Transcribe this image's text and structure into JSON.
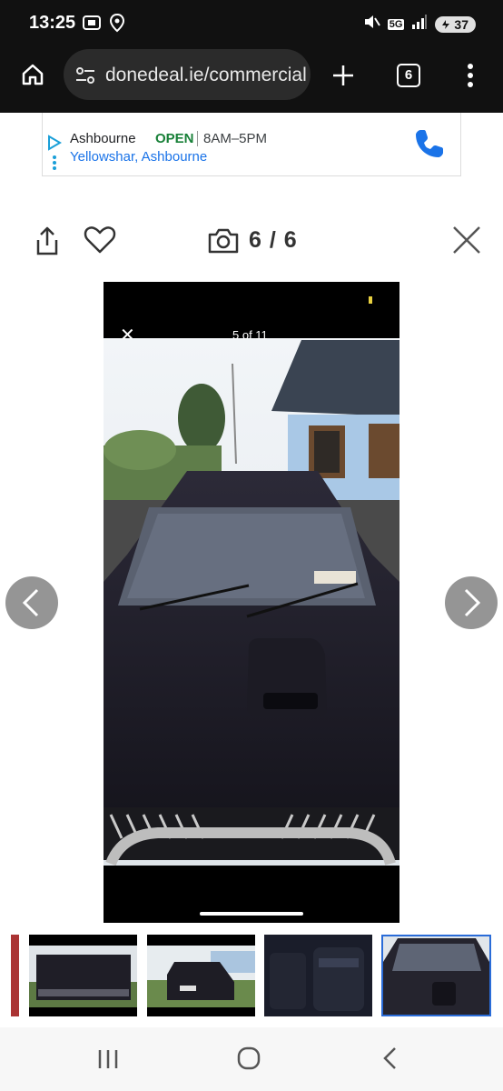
{
  "status_bar": {
    "time": "13:25",
    "battery": "37",
    "network": "5G"
  },
  "browser": {
    "url": "donedeal.ie/commercial",
    "tab_count": "6"
  },
  "ad": {
    "business_name": "Ashbourne",
    "open_status": "OPEN",
    "hours": "8AM–5PM",
    "location": "Yellowshar, Ashbourne"
  },
  "gallery": {
    "counter": "6 / 6",
    "photo_overlay": {
      "counter": "5 of 11"
    }
  },
  "colors": {
    "accent": "#2a6cd8",
    "open_green": "#188038",
    "link_blue": "#1a73e8",
    "phone_blue": "#1a73e8"
  }
}
